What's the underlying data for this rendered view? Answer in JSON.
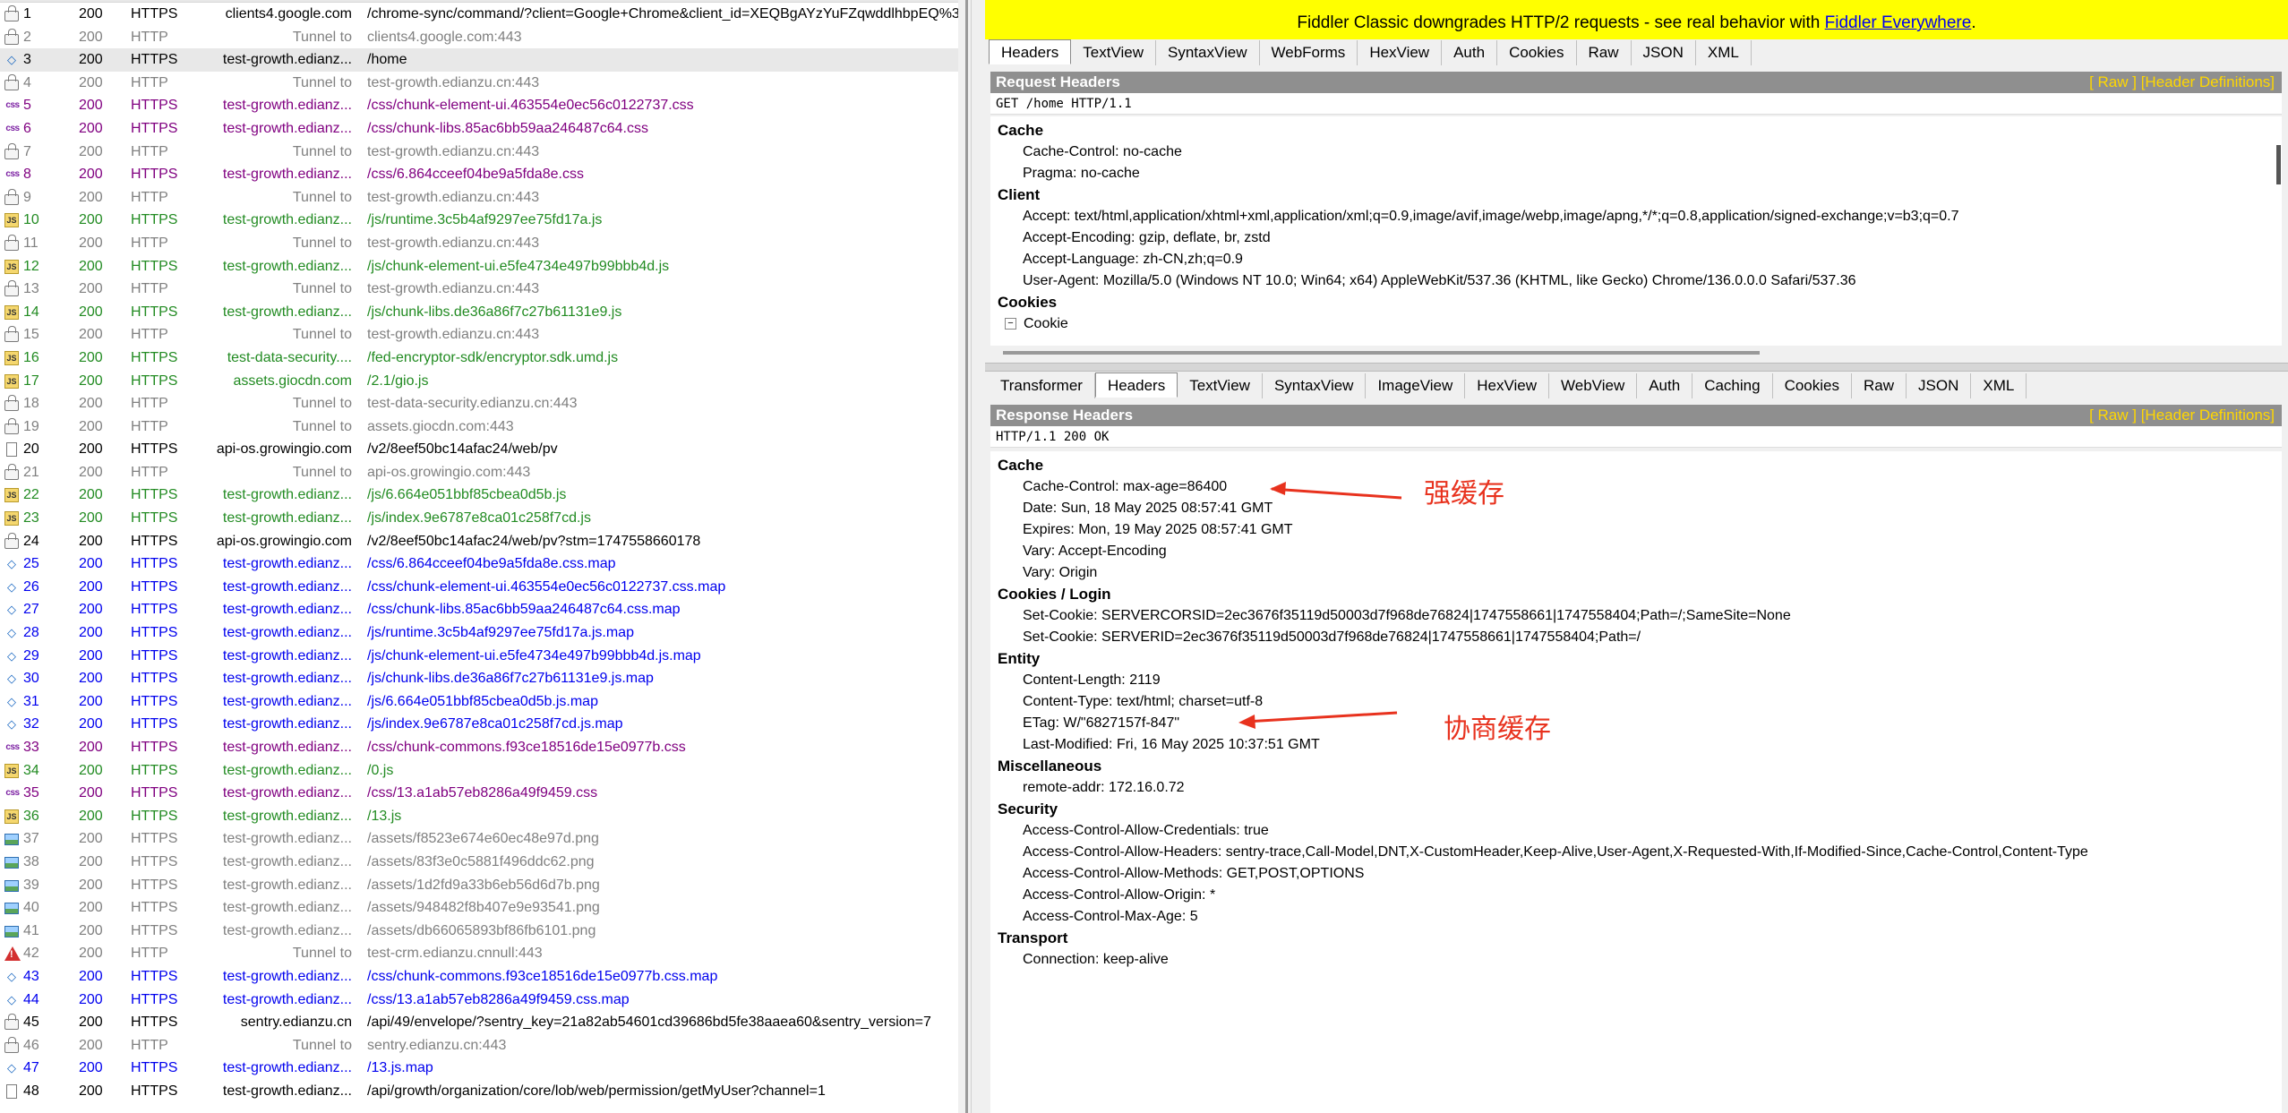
{
  "sessions": [
    {
      "icon": "lock",
      "num": "1",
      "result": "200",
      "protocol": "HTTPS",
      "host": "clients4.google.com",
      "url": "/chrome-sync/command/?client=Google+Chrome&client_id=XEQBgAYzYuFZqwddlhbpEQ%3",
      "color": "black"
    },
    {
      "icon": "lock",
      "num": "2",
      "result": "200",
      "protocol": "HTTP",
      "host": "Tunnel to",
      "url": "clients4.google.com:443",
      "color": "gray"
    },
    {
      "icon": "html",
      "num": "3",
      "result": "200",
      "protocol": "HTTPS",
      "host": "test-growth.edianz...",
      "url": "/home",
      "color": "black",
      "selected": true
    },
    {
      "icon": "lock",
      "num": "4",
      "result": "200",
      "protocol": "HTTP",
      "host": "Tunnel to",
      "url": "test-growth.edianzu.cn:443",
      "color": "gray"
    },
    {
      "icon": "css",
      "num": "5",
      "result": "200",
      "protocol": "HTTPS",
      "host": "test-growth.edianz...",
      "url": "/css/chunk-element-ui.463554e0ec56c0122737.css",
      "color": "purple"
    },
    {
      "icon": "css",
      "num": "6",
      "result": "200",
      "protocol": "HTTPS",
      "host": "test-growth.edianz...",
      "url": "/css/chunk-libs.85ac6bb59aa246487c64.css",
      "color": "purple"
    },
    {
      "icon": "lock",
      "num": "7",
      "result": "200",
      "protocol": "HTTP",
      "host": "Tunnel to",
      "url": "test-growth.edianzu.cn:443",
      "color": "gray"
    },
    {
      "icon": "css",
      "num": "8",
      "result": "200",
      "protocol": "HTTPS",
      "host": "test-growth.edianz...",
      "url": "/css/6.864cceef04be9a5fda8e.css",
      "color": "purple"
    },
    {
      "icon": "lock",
      "num": "9",
      "result": "200",
      "protocol": "HTTP",
      "host": "Tunnel to",
      "url": "test-growth.edianzu.cn:443",
      "color": "gray"
    },
    {
      "icon": "js",
      "num": "10",
      "result": "200",
      "protocol": "HTTPS",
      "host": "test-growth.edianz...",
      "url": "/js/runtime.3c5b4af9297ee75fd17a.js",
      "color": "green"
    },
    {
      "icon": "lock",
      "num": "11",
      "result": "200",
      "protocol": "HTTP",
      "host": "Tunnel to",
      "url": "test-growth.edianzu.cn:443",
      "color": "gray"
    },
    {
      "icon": "js",
      "num": "12",
      "result": "200",
      "protocol": "HTTPS",
      "host": "test-growth.edianz...",
      "url": "/js/chunk-element-ui.e5fe4734e497b99bbb4d.js",
      "color": "green"
    },
    {
      "icon": "lock",
      "num": "13",
      "result": "200",
      "protocol": "HTTP",
      "host": "Tunnel to",
      "url": "test-growth.edianzu.cn:443",
      "color": "gray"
    },
    {
      "icon": "js",
      "num": "14",
      "result": "200",
      "protocol": "HTTPS",
      "host": "test-growth.edianz...",
      "url": "/js/chunk-libs.de36a86f7c27b61131e9.js",
      "color": "green"
    },
    {
      "icon": "lock",
      "num": "15",
      "result": "200",
      "protocol": "HTTP",
      "host": "Tunnel to",
      "url": "test-growth.edianzu.cn:443",
      "color": "gray"
    },
    {
      "icon": "js",
      "num": "16",
      "result": "200",
      "protocol": "HTTPS",
      "host": "test-data-security....",
      "url": "/fed-encryptor-sdk/encryptor.sdk.umd.js",
      "color": "green"
    },
    {
      "icon": "js",
      "num": "17",
      "result": "200",
      "protocol": "HTTPS",
      "host": "assets.giocdn.com",
      "url": "/2.1/gio.js",
      "color": "green"
    },
    {
      "icon": "lock",
      "num": "18",
      "result": "200",
      "protocol": "HTTP",
      "host": "Tunnel to",
      "url": "test-data-security.edianzu.cn:443",
      "color": "gray"
    },
    {
      "icon": "lock",
      "num": "19",
      "result": "200",
      "protocol": "HTTP",
      "host": "Tunnel to",
      "url": "assets.giocdn.com:443",
      "color": "gray"
    },
    {
      "icon": "doc",
      "num": "20",
      "result": "200",
      "protocol": "HTTPS",
      "host": "api-os.growingio.com",
      "url": "/v2/8eef50bc14afac24/web/pv",
      "color": "black"
    },
    {
      "icon": "lock",
      "num": "21",
      "result": "200",
      "protocol": "HTTP",
      "host": "Tunnel to",
      "url": "api-os.growingio.com:443",
      "color": "gray"
    },
    {
      "icon": "js",
      "num": "22",
      "result": "200",
      "protocol": "HTTPS",
      "host": "test-growth.edianz...",
      "url": "/js/6.664e051bbf85cbea0d5b.js",
      "color": "green"
    },
    {
      "icon": "js",
      "num": "23",
      "result": "200",
      "protocol": "HTTPS",
      "host": "test-growth.edianz...",
      "url": "/js/index.9e6787e8ca01c258f7cd.js",
      "color": "green"
    },
    {
      "icon": "lock",
      "num": "24",
      "result": "200",
      "protocol": "HTTPS",
      "host": "api-os.growingio.com",
      "url": "/v2/8eef50bc14afac24/web/pv?stm=1747558660178",
      "color": "black"
    },
    {
      "icon": "html",
      "num": "25",
      "result": "200",
      "protocol": "HTTPS",
      "host": "test-growth.edianz...",
      "url": "/css/6.864cceef04be9a5fda8e.css.map",
      "color": "blue"
    },
    {
      "icon": "html",
      "num": "26",
      "result": "200",
      "protocol": "HTTPS",
      "host": "test-growth.edianz...",
      "url": "/css/chunk-element-ui.463554e0ec56c0122737.css.map",
      "color": "blue"
    },
    {
      "icon": "html",
      "num": "27",
      "result": "200",
      "protocol": "HTTPS",
      "host": "test-growth.edianz...",
      "url": "/css/chunk-libs.85ac6bb59aa246487c64.css.map",
      "color": "blue"
    },
    {
      "icon": "html",
      "num": "28",
      "result": "200",
      "protocol": "HTTPS",
      "host": "test-growth.edianz...",
      "url": "/js/runtime.3c5b4af9297ee75fd17a.js.map",
      "color": "blue"
    },
    {
      "icon": "html",
      "num": "29",
      "result": "200",
      "protocol": "HTTPS",
      "host": "test-growth.edianz...",
      "url": "/js/chunk-element-ui.e5fe4734e497b99bbb4d.js.map",
      "color": "blue"
    },
    {
      "icon": "html",
      "num": "30",
      "result": "200",
      "protocol": "HTTPS",
      "host": "test-growth.edianz...",
      "url": "/js/chunk-libs.de36a86f7c27b61131e9.js.map",
      "color": "blue"
    },
    {
      "icon": "html",
      "num": "31",
      "result": "200",
      "protocol": "HTTPS",
      "host": "test-growth.edianz...",
      "url": "/js/6.664e051bbf85cbea0d5b.js.map",
      "color": "blue"
    },
    {
      "icon": "html",
      "num": "32",
      "result": "200",
      "protocol": "HTTPS",
      "host": "test-growth.edianz...",
      "url": "/js/index.9e6787e8ca01c258f7cd.js.map",
      "color": "blue"
    },
    {
      "icon": "css",
      "num": "33",
      "result": "200",
      "protocol": "HTTPS",
      "host": "test-growth.edianz...",
      "url": "/css/chunk-commons.f93ce18516de15e0977b.css",
      "color": "purple"
    },
    {
      "icon": "js",
      "num": "34",
      "result": "200",
      "protocol": "HTTPS",
      "host": "test-growth.edianz...",
      "url": "/0.js",
      "color": "green"
    },
    {
      "icon": "css",
      "num": "35",
      "result": "200",
      "protocol": "HTTPS",
      "host": "test-growth.edianz...",
      "url": "/css/13.a1ab57eb8286a49f9459.css",
      "color": "purple"
    },
    {
      "icon": "js",
      "num": "36",
      "result": "200",
      "protocol": "HTTPS",
      "host": "test-growth.edianz...",
      "url": "/13.js",
      "color": "green"
    },
    {
      "icon": "img",
      "num": "37",
      "result": "200",
      "protocol": "HTTPS",
      "host": "test-growth.edianz...",
      "url": "/assets/f8523e674e60ec48e97d.png",
      "color": "gray"
    },
    {
      "icon": "img",
      "num": "38",
      "result": "200",
      "protocol": "HTTPS",
      "host": "test-growth.edianz...",
      "url": "/assets/83f3e0c5881f496ddc62.png",
      "color": "gray"
    },
    {
      "icon": "img",
      "num": "39",
      "result": "200",
      "protocol": "HTTPS",
      "host": "test-growth.edianz...",
      "url": "/assets/1d2fd9a33b6eb56d6d7b.png",
      "color": "gray"
    },
    {
      "icon": "img",
      "num": "40",
      "result": "200",
      "protocol": "HTTPS",
      "host": "test-growth.edianz...",
      "url": "/assets/948482f8b407e9e93541.png",
      "color": "gray"
    },
    {
      "icon": "img",
      "num": "41",
      "result": "200",
      "protocol": "HTTPS",
      "host": "test-growth.edianz...",
      "url": "/assets/db66065893bf86fb6101.png",
      "color": "gray"
    },
    {
      "icon": "warn",
      "num": "42",
      "result": "200",
      "protocol": "HTTP",
      "host": "Tunnel to",
      "url": "test-crm.edianzu.cnnull:443",
      "color": "gray"
    },
    {
      "icon": "html",
      "num": "43",
      "result": "200",
      "protocol": "HTTPS",
      "host": "test-growth.edianz...",
      "url": "/css/chunk-commons.f93ce18516de15e0977b.css.map",
      "color": "blue"
    },
    {
      "icon": "html",
      "num": "44",
      "result": "200",
      "protocol": "HTTPS",
      "host": "test-growth.edianz...",
      "url": "/css/13.a1ab57eb8286a49f9459.css.map",
      "color": "blue"
    },
    {
      "icon": "lock",
      "num": "45",
      "result": "200",
      "protocol": "HTTPS",
      "host": "sentry.edianzu.cn",
      "url": "/api/49/envelope/?sentry_key=21a82ab54601cd39686bd5fe38aaea60&sentry_version=7",
      "color": "black"
    },
    {
      "icon": "lock",
      "num": "46",
      "result": "200",
      "protocol": "HTTP",
      "host": "Tunnel to",
      "url": "sentry.edianzu.cn:443",
      "color": "gray"
    },
    {
      "icon": "html",
      "num": "47",
      "result": "200",
      "protocol": "HTTPS",
      "host": "test-growth.edianz...",
      "url": "/13.js.map",
      "color": "blue"
    },
    {
      "icon": "doc",
      "num": "48",
      "result": "200",
      "protocol": "HTTPS",
      "host": "test-growth.edianz...",
      "url": "/api/growth/organization/core/lob/web/permission/getMyUser?channel=1",
      "color": "black"
    }
  ],
  "colors": {
    "black": "#000000",
    "gray": "#808080",
    "purple": "#800080",
    "green": "#228b22",
    "blue": "#0000ee",
    "banner": "#ffff00",
    "annotation": "#e8321e"
  },
  "banner": {
    "text": "Fiddler Classic downgrades HTTP/2 requests - see real behavior with ",
    "link": "Fiddler Everywhere",
    "tail": "."
  },
  "request_tabs": [
    "Headers",
    "TextView",
    "SyntaxView",
    "WebForms",
    "HexView",
    "Auth",
    "Cookies",
    "Raw",
    "JSON",
    "XML"
  ],
  "request": {
    "title": "Request Headers",
    "links": "[ Raw ]   [Header Definitions]",
    "status_line": "GET /home HTTP/1.1",
    "groups": [
      {
        "name": "Cache",
        "items": [
          "Cache-Control: no-cache",
          "Pragma: no-cache"
        ]
      },
      {
        "name": "Client",
        "items": [
          "Accept: text/html,application/xhtml+xml,application/xml;q=0.9,image/avif,image/webp,image/apng,*/*;q=0.8,application/signed-exchange;v=b3;q=0.7",
          "Accept-Encoding: gzip, deflate, br, zstd",
          "Accept-Language: zh-CN,zh;q=0.9",
          "User-Agent: Mozilla/5.0 (Windows NT 10.0; Win64; x64) AppleWebKit/537.36 (KHTML, like Gecko) Chrome/136.0.0.0 Safari/537.36"
        ]
      },
      {
        "name": "Cookies",
        "items": []
      }
    ],
    "cookie_node": "Cookie"
  },
  "response_tabs": [
    "Transformer",
    "Headers",
    "TextView",
    "SyntaxView",
    "ImageView",
    "HexView",
    "WebView",
    "Auth",
    "Caching",
    "Cookies",
    "Raw",
    "JSON",
    "XML"
  ],
  "response": {
    "title": "Response Headers",
    "links": "[ Raw ]   [Header Definitions]",
    "status_line": "HTTP/1.1 200 OK",
    "groups": [
      {
        "name": "Cache",
        "items": [
          "Cache-Control: max-age=86400",
          "Date: Sun, 18 May 2025 08:57:41 GMT",
          "Expires: Mon, 19 May 2025 08:57:41 GMT",
          "Vary: Accept-Encoding",
          "Vary: Origin"
        ]
      },
      {
        "name": "Cookies / Login",
        "items": [
          "Set-Cookie: SERVERCORSID=2ec3676f35119d50003d7f968de76824|1747558661|1747558404;Path=/;SameSite=None",
          "Set-Cookie: SERVERID=2ec3676f35119d50003d7f968de76824|1747558661|1747558404;Path=/"
        ]
      },
      {
        "name": "Entity",
        "items": [
          "Content-Length: 2119",
          "Content-Type: text/html; charset=utf-8",
          "ETag: W/\"6827157f-847\"",
          "Last-Modified: Fri, 16 May 2025 10:37:51 GMT"
        ]
      },
      {
        "name": "Miscellaneous",
        "items": [
          "remote-addr: 172.16.0.72"
        ]
      },
      {
        "name": "Security",
        "items": [
          "Access-Control-Allow-Credentials: true",
          "Access-Control-Allow-Headers: sentry-trace,Call-Model,DNT,X-CustomHeader,Keep-Alive,User-Agent,X-Requested-With,If-Modified-Since,Cache-Control,Content-Type",
          "Access-Control-Allow-Methods: GET,POST,OPTIONS",
          "Access-Control-Allow-Origin: *",
          "Access-Control-Max-Age: 5"
        ]
      },
      {
        "name": "Transport",
        "items": [
          "Connection: keep-alive"
        ]
      }
    ]
  },
  "annotations": {
    "strong_cache": "强缓存",
    "negotiated_cache": "协商缓存"
  }
}
